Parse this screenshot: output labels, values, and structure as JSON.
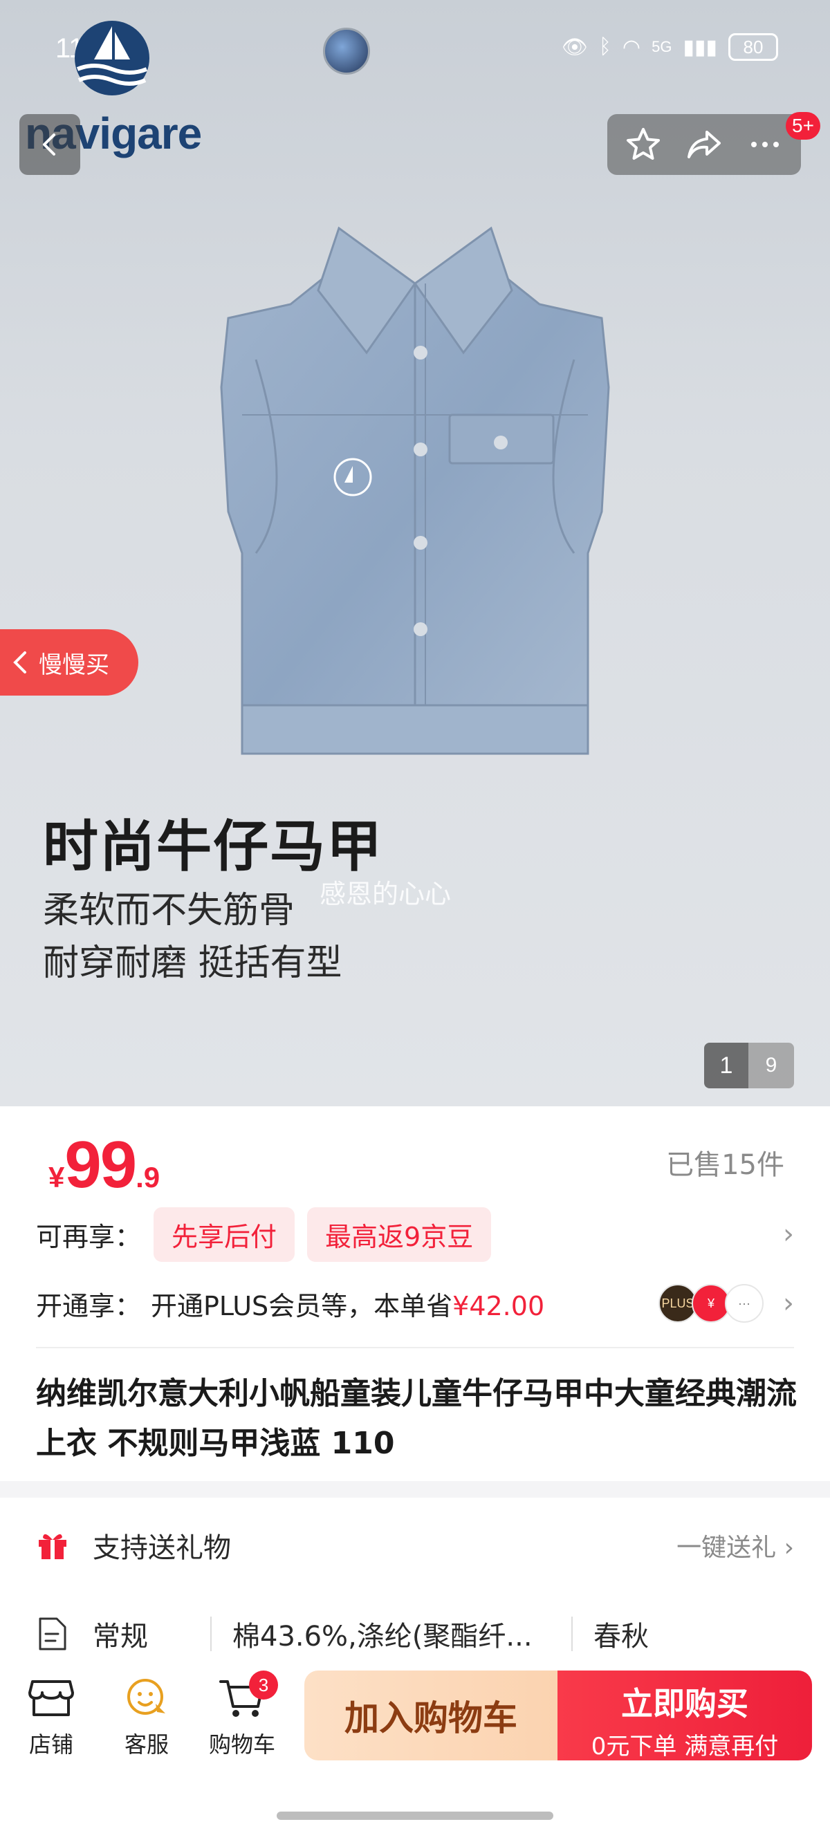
{
  "status_bar": {
    "time": "11:52",
    "battery": "80",
    "network": "5G"
  },
  "brand": {
    "name": "navigare"
  },
  "header": {
    "cart_message_badge": "5+"
  },
  "hero": {
    "slow_buy_label": "慢慢买",
    "title": "时尚牛仔马甲",
    "subtitle_1": "柔软而不失筋骨",
    "subtitle_2": "耐穿耐磨 挺括有型",
    "watermark": "感恩的心心",
    "image_index": "1",
    "image_total": "9"
  },
  "price": {
    "currency": "¥",
    "integer": "99",
    "decimal": ".9",
    "sold": "已售15件"
  },
  "promotions": {
    "label": "可再享：",
    "tags": [
      "先享后付",
      "最高返9京豆"
    ]
  },
  "plus": {
    "label": "开通享：",
    "text": "开通PLUS会员等，本单省",
    "amount": "¥42.00",
    "icons": [
      "PLUS",
      "¥",
      "···"
    ]
  },
  "product": {
    "title": "纳维凯尔意大利小帆船童装儿童牛仔马甲中大童经典潮流上衣 不规则马甲浅蓝 110"
  },
  "gift": {
    "label": "支持送礼物",
    "action": "一键送礼"
  },
  "specs": {
    "label": "常规",
    "material": "棉43.6%,涤纶(聚酯纤...",
    "season": "春秋"
  },
  "bottom_bar": {
    "store": "店铺",
    "service": "客服",
    "cart": "购物车",
    "cart_count": "3",
    "add_to_cart": "加入购物车",
    "buy_now": "立即购买",
    "buy_now_sub": "0元下单 满意再付"
  },
  "colors": {
    "accent_red": "#f2213a",
    "brand_navy": "#1d4374",
    "add_cart_bg": "#fbd3b0"
  }
}
